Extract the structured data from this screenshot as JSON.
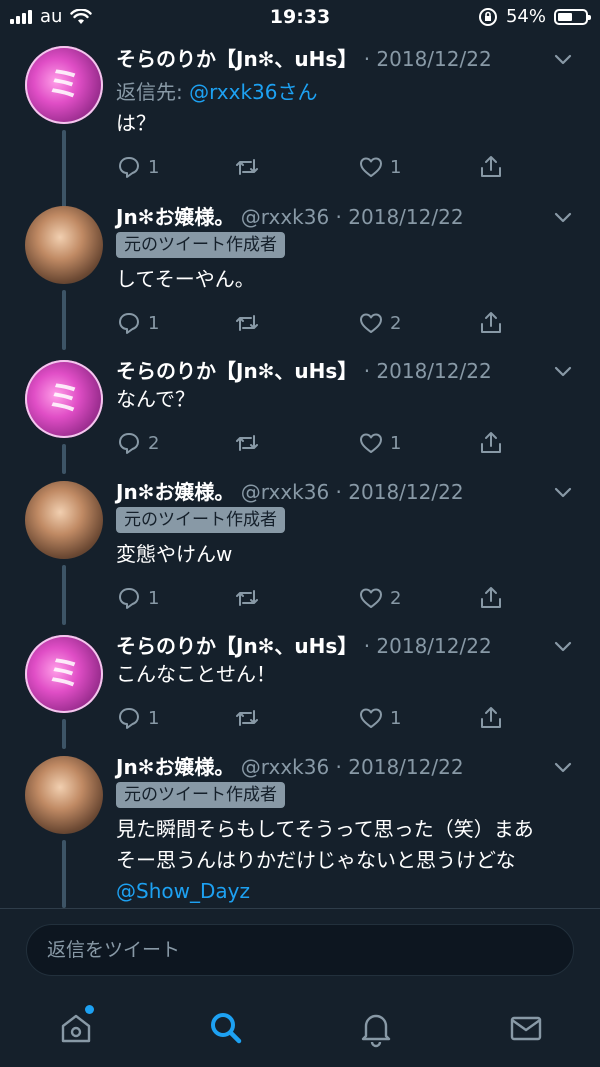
{
  "status_bar": {
    "carrier": "au",
    "time": "19:33",
    "battery_percent": "54%"
  },
  "tweets": [
    {
      "author": "そらのりか【Jn✻、uHs】",
      "handle": "",
      "date": "2018/12/22",
      "reply_to_label": "返信先:",
      "reply_to_mention": "@rxxk36さん",
      "text": "は？",
      "replies": "1",
      "retweets": "",
      "likes": "1"
    },
    {
      "author": "Jn✻お嬢様。",
      "handle": "@rxxk36",
      "date": "2018/12/22",
      "badge": "元のツイート作成者",
      "text": "してそーやん。",
      "replies": "1",
      "retweets": "",
      "likes": "2"
    },
    {
      "author": "そらのりか【Jn✻、uHs】",
      "handle": "",
      "date": "2018/12/22",
      "text": "なんで？",
      "replies": "2",
      "retweets": "",
      "likes": "1"
    },
    {
      "author": "Jn✻お嬢様。",
      "handle": "@rxxk36",
      "date": "2018/12/22",
      "badge": "元のツイート作成者",
      "text": "変態やけんw",
      "replies": "1",
      "retweets": "",
      "likes": "2"
    },
    {
      "author": "そらのりか【Jn✻、uHs】",
      "handle": "",
      "date": "2018/12/22",
      "text": "こんなことせん！",
      "replies": "1",
      "retweets": "",
      "likes": "1"
    },
    {
      "author": "Jn✻お嬢様。",
      "handle": "@rxxk36",
      "date": "2018/12/22",
      "badge": "元のツイート作成者",
      "text_line1": "見た瞬間そらもしてそうって思った（笑）まあ",
      "text_line2": "そー思うんはりかだけじゃないと思うけどな",
      "text_mention": "@Show_Dayz"
    }
  ],
  "reply_bar": {
    "placeholder": "返信をツイート"
  },
  "tab_bar": {
    "items": [
      "home-icon",
      "search-icon",
      "bell-icon",
      "mail-icon"
    ],
    "active": "search-icon",
    "colors": {
      "active": "#1da1f2",
      "inactive": "#8899a6"
    }
  },
  "colors": {
    "background": "#15202b",
    "accent": "#1da1f2",
    "muted": "#8899a6",
    "badge_bg": "#8899a6"
  }
}
